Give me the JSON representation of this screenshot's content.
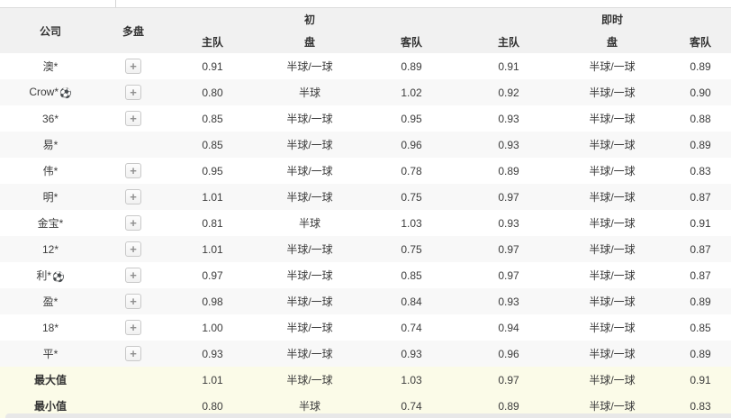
{
  "table": {
    "header": {
      "company": "公司",
      "multi": "多盘",
      "initial_top": "初",
      "live_top": "即时",
      "pan": "盘",
      "home": "主队",
      "away": "客队"
    },
    "rows": [
      {
        "company": "澳*",
        "ball": false,
        "multi": true,
        "initial_home": "0.91",
        "initial_pan": "半球/一球",
        "initial_away": "0.89",
        "live_home": "0.91",
        "live_pan": "半球/一球",
        "live_away": "0.89"
      },
      {
        "company": "Crow*",
        "ball": true,
        "multi": true,
        "initial_home": "0.80",
        "initial_pan": "半球",
        "initial_away": "1.02",
        "live_home": "0.92",
        "live_pan": "半球/一球",
        "live_away": "0.90"
      },
      {
        "company": "36*",
        "ball": false,
        "multi": true,
        "initial_home": "0.85",
        "initial_pan": "半球/一球",
        "initial_away": "0.95",
        "live_home": "0.93",
        "live_pan": "半球/一球",
        "live_away": "0.88"
      },
      {
        "company": "易*",
        "ball": false,
        "multi": false,
        "initial_home": "0.85",
        "initial_pan": "半球/一球",
        "initial_away": "0.96",
        "live_home": "0.93",
        "live_pan": "半球/一球",
        "live_away": "0.89"
      },
      {
        "company": "伟*",
        "ball": false,
        "multi": true,
        "initial_home": "0.95",
        "initial_pan": "半球/一球",
        "initial_away": "0.78",
        "live_home": "0.89",
        "live_pan": "半球/一球",
        "live_away": "0.83"
      },
      {
        "company": "明*",
        "ball": false,
        "multi": true,
        "initial_home": "1.01",
        "initial_pan": "半球/一球",
        "initial_away": "0.75",
        "live_home": "0.97",
        "live_pan": "半球/一球",
        "live_away": "0.87"
      },
      {
        "company": "金宝*",
        "ball": false,
        "multi": true,
        "initial_home": "0.81",
        "initial_pan": "半球",
        "initial_away": "1.03",
        "live_home": "0.93",
        "live_pan": "半球/一球",
        "live_away": "0.91"
      },
      {
        "company": "12*",
        "ball": false,
        "multi": true,
        "initial_home": "1.01",
        "initial_pan": "半球/一球",
        "initial_away": "0.75",
        "live_home": "0.97",
        "live_pan": "半球/一球",
        "live_away": "0.87"
      },
      {
        "company": "利*",
        "ball": true,
        "multi": true,
        "initial_home": "0.97",
        "initial_pan": "半球/一球",
        "initial_away": "0.85",
        "live_home": "0.97",
        "live_pan": "半球/一球",
        "live_away": "0.87"
      },
      {
        "company": "盈*",
        "ball": false,
        "multi": true,
        "initial_home": "0.98",
        "initial_pan": "半球/一球",
        "initial_away": "0.84",
        "live_home": "0.93",
        "live_pan": "半球/一球",
        "live_away": "0.89"
      },
      {
        "company": "18*",
        "ball": false,
        "multi": true,
        "initial_home": "1.00",
        "initial_pan": "半球/一球",
        "initial_away": "0.74",
        "live_home": "0.94",
        "live_pan": "半球/一球",
        "live_away": "0.85"
      },
      {
        "company": "平*",
        "ball": false,
        "multi": true,
        "initial_home": "0.93",
        "initial_pan": "半球/一球",
        "initial_away": "0.93",
        "live_home": "0.96",
        "live_pan": "半球/一球",
        "live_away": "0.89"
      }
    ],
    "summary": [
      {
        "label": "最大值",
        "initial_home": "1.01",
        "initial_pan": "半球/一球",
        "initial_away": "1.03",
        "live_home": "0.97",
        "live_pan": "半球/一球",
        "live_away": "0.91"
      },
      {
        "label": "最小值",
        "initial_home": "0.80",
        "initial_pan": "半球",
        "initial_away": "0.74",
        "live_home": "0.89",
        "live_pan": "半球/一球",
        "live_away": "0.83"
      }
    ]
  },
  "icons": {
    "expand_plus": "+",
    "football": "⚽"
  },
  "colors": {
    "header_bg": "#f1f1f1",
    "alt_row_bg": "#f8f8f8",
    "summary_bg": "#fbfbe8",
    "border": "#dcdcdc"
  }
}
